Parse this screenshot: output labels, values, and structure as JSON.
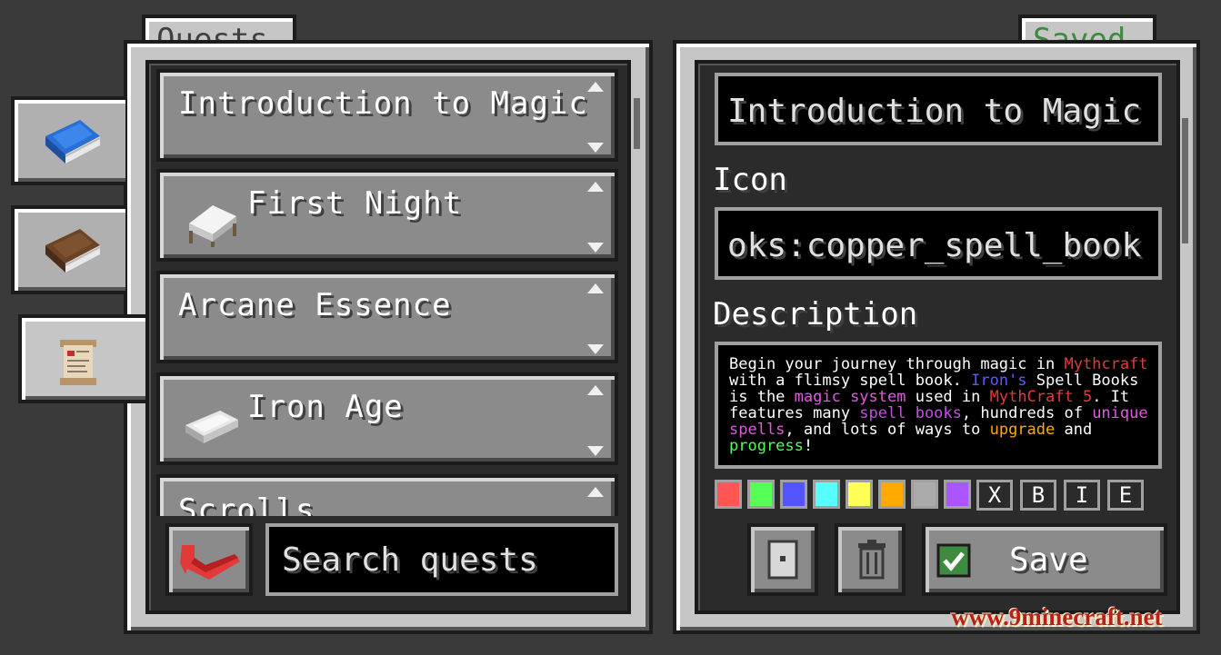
{
  "left_panel": {
    "tab_title": "Quests",
    "quests": [
      {
        "title": "Introduction to Magic",
        "icon": ""
      },
      {
        "title": "First Night",
        "icon": "bed-icon"
      },
      {
        "title": "Arcane Essence",
        "icon": ""
      },
      {
        "title": "Iron Age",
        "icon": "iron-ingot-icon"
      },
      {
        "title": "Scrolls",
        "icon": ""
      }
    ],
    "search_placeholder": "Search quests",
    "back_icon": "red-back-arrow-icon"
  },
  "side_tabs": [
    {
      "icon": "blue-book-icon"
    },
    {
      "icon": "brown-book-icon"
    },
    {
      "icon": "scroll-icon",
      "active": true
    }
  ],
  "right_panel": {
    "tab_title": "Saved",
    "title_value": "Introduction to Magic",
    "icon_label": "Icon",
    "icon_value": "oks:copper_spell_book",
    "description_label": "Description",
    "description_segments": [
      {
        "text": "Begin your journey through magic in ",
        "color": "#ffffff"
      },
      {
        "text": "Mythcraft",
        "color": "#e23a3a"
      },
      {
        "text": " with a flimsy spell book. ",
        "color": "#ffffff"
      },
      {
        "text": "Iron's",
        "color": "#5a5aff"
      },
      {
        "text": " Spell Books is the ",
        "color": "#ffffff"
      },
      {
        "text": "magic system",
        "color": "#e05ae0"
      },
      {
        "text": " used in ",
        "color": "#ffffff"
      },
      {
        "text": "MythCraft 5",
        "color": "#e23a3a"
      },
      {
        "text": ". It features many ",
        "color": "#ffffff"
      },
      {
        "text": "spell books",
        "color": "#c050e0"
      },
      {
        "text": ", hundreds of ",
        "color": "#ffffff"
      },
      {
        "text": "unique spells",
        "color": "#e05ae0"
      },
      {
        "text": ", and lots of ways to ",
        "color": "#ffffff"
      },
      {
        "text": "upgrade",
        "color": "#ffaa00"
      },
      {
        "text": " and ",
        "color": "#ffffff"
      },
      {
        "text": "progress",
        "color": "#55ff55"
      },
      {
        "text": "!",
        "color": "#ffffff"
      }
    ],
    "color_swatches": [
      "#ff5555",
      "#55ff55",
      "#5555ff",
      "#55ffff",
      "#ffff55",
      "#ffaa00",
      "#aaaaaa",
      "#aa55ff"
    ],
    "format_buttons": [
      "X",
      "B",
      "I",
      "E"
    ],
    "save_label": "Save"
  },
  "watermark": "www.9minecraft.net"
}
